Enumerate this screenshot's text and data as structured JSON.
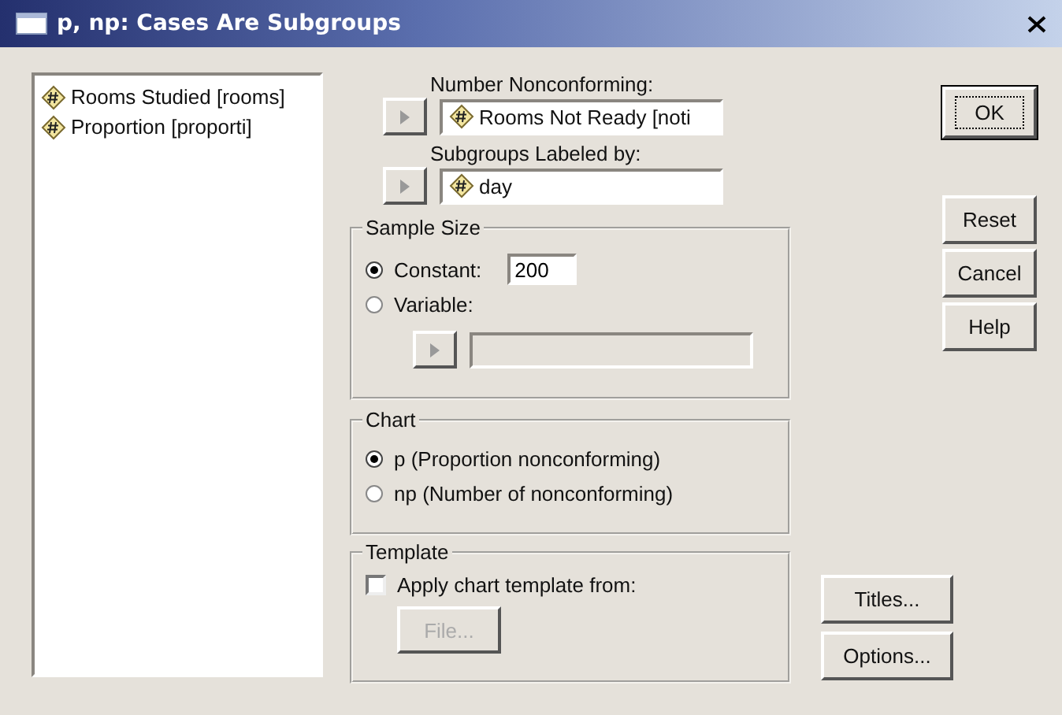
{
  "window": {
    "title": "p, np: Cases Are Subgroups"
  },
  "variables": [
    {
      "label": "Rooms Studied [rooms]",
      "selected": false
    },
    {
      "label": "Proportion [proporti]",
      "selected": false
    }
  ],
  "fields": [
    {
      "label": "Number Nonconforming:",
      "value": "Rooms Not Ready [noti"
    },
    {
      "label": "Subgroups Labeled by:",
      "value": "day"
    }
  ],
  "sample_size": {
    "title": "Sample Size",
    "options": [
      {
        "label": "Constant:",
        "selected": true
      },
      {
        "label": "Variable:",
        "selected": false
      }
    ],
    "constant_value": "200"
  },
  "chart": {
    "title": "Chart",
    "options": [
      {
        "label": "p (Proportion nonconforming)",
        "selected": true
      },
      {
        "label": "np (Number of nonconforming)",
        "selected": false
      }
    ]
  },
  "template": {
    "title": "Template",
    "checkbox": {
      "label": "Apply chart template from:",
      "checked": false
    },
    "file_button": {
      "label": "File...",
      "disabled": true
    }
  },
  "ok_button": {
    "label": "OK",
    "default": true
  },
  "side_buttons": [
    {
      "label": "Reset"
    },
    {
      "label": "Cancel"
    },
    {
      "label": "Help"
    }
  ],
  "lower_buttons": [
    {
      "label": "Titles..."
    },
    {
      "label": "Options..."
    }
  ]
}
